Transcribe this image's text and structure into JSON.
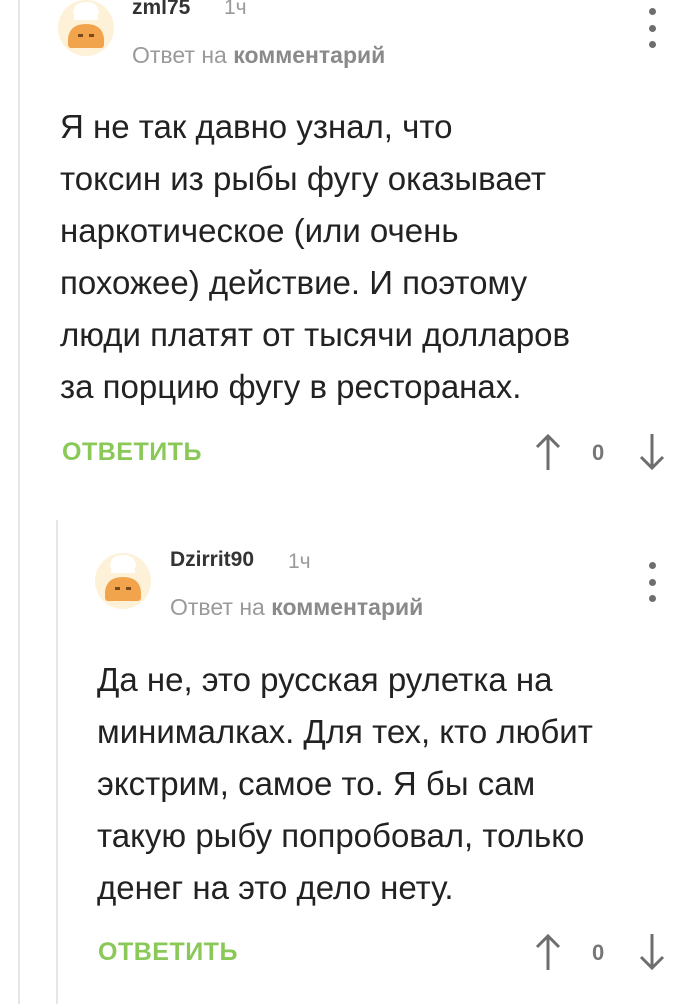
{
  "comments": [
    {
      "username": "zml75",
      "time": "1ч",
      "reply_prefix": "Ответ на",
      "reply_target": "комментарий",
      "text_lines": [
        "Я не так давно узнал, что",
        "токсин из рыбы фугу оказывает",
        "наркотическое (или очень",
        "похожее) действие. И поэтому",
        "люди платят от тысячи долларов",
        "за порцию фугу в ресторанах."
      ],
      "reply_label": "ОТВЕТИТЬ",
      "score": "0"
    },
    {
      "username": "Dzirrit90",
      "time": "1ч",
      "reply_prefix": "Ответ на",
      "reply_target": "комментарий",
      "text_lines": [
        "Да не, это русская рулетка на",
        "минималках. Для тех, кто любит",
        "экстрим, самое то. Я бы сам",
        "такую рыбу попробовал, только",
        "денег на это дело нету."
      ],
      "reply_label": "ОТВЕТИТЬ",
      "score": "0"
    }
  ],
  "icons": {
    "more": "vertical-dots-icon",
    "upvote": "arrow-up-icon",
    "downvote": "arrow-down-icon",
    "avatar": "default-avatar-icon"
  },
  "colors": {
    "accent": "#8ac858",
    "muted": "#9a9a9a",
    "thread_line": "#e6e6e6"
  }
}
